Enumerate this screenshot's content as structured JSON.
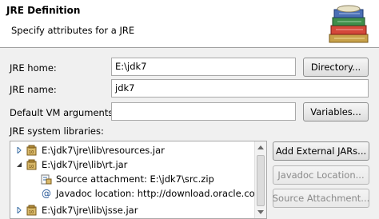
{
  "header": {
    "title": "JRE Definition",
    "subtitle": "Specify attributes for a JRE"
  },
  "form": {
    "jre_home_label": "JRE home:",
    "jre_home_value": "E:\\jdk7",
    "directory_button": "Directory...",
    "jre_name_label": "JRE name:",
    "jre_name_value": "jdk7",
    "vm_args_label": "Default VM arguments:",
    "vm_args_value": "",
    "variables_button": "Variables...",
    "libraries_label": "JRE system libraries:"
  },
  "libraries": {
    "items": [
      {
        "expanded": false,
        "label": "E:\\jdk7\\jre\\lib\\resources.jar"
      },
      {
        "expanded": true,
        "label": "E:\\jdk7\\jre\\lib\\rt.jar"
      },
      {
        "child": "source",
        "label": "Source attachment: E:\\jdk7\\src.zip"
      },
      {
        "child": "javadoc",
        "label": "Javadoc location: http://download.oracle.com/"
      },
      {
        "expanded": false,
        "label": "E:\\jdk7\\jre\\lib\\jsse.jar"
      }
    ]
  },
  "buttons": {
    "add_external_jars": "Add External JARs...",
    "javadoc_location": "Javadoc Location...",
    "source_attachment": "Source Attachment..."
  },
  "colors": {
    "header_bg": "#ffffff",
    "dialog_bg": "#f0f0f0",
    "twisty": "#3a6ea5"
  }
}
